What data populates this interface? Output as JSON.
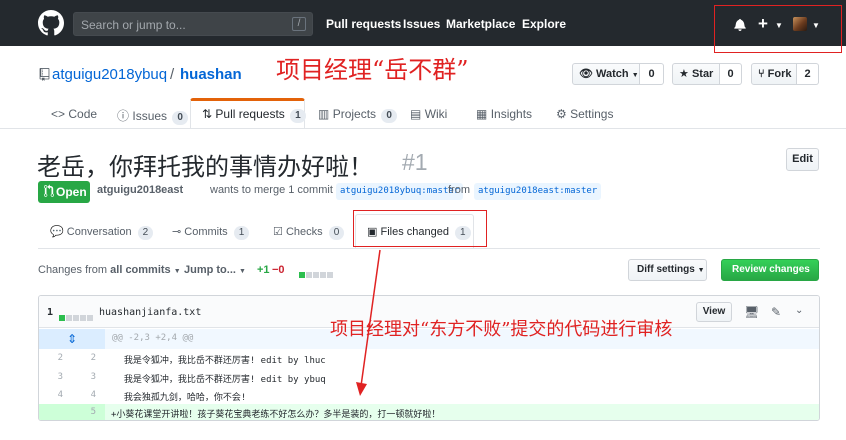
{
  "header": {
    "search_placeholder": "Search or jump to...",
    "slash_key": "/",
    "nav": [
      "Pull requests",
      "Issues",
      "Marketplace",
      "Explore"
    ]
  },
  "repo": {
    "owner": "atguigu2018ybuq",
    "separator": "/",
    "name": "huashan",
    "watch_label": "Watch",
    "watch_count": "0",
    "star_label": "Star",
    "star_count": "0",
    "fork_label": "Fork",
    "fork_count": "2"
  },
  "repo_tabs": [
    {
      "label": "Code"
    },
    {
      "label": "Issues",
      "count": "0"
    },
    {
      "label": "Pull requests",
      "count": "1"
    },
    {
      "label": "Projects",
      "count": "0"
    },
    {
      "label": "Wiki"
    },
    {
      "label": "Insights"
    },
    {
      "label": "Settings"
    }
  ],
  "annotations": {
    "manager": "项目经理“岳不群”",
    "review": "项目经理对“东方不败”提交的代码进行审核"
  },
  "pr": {
    "title": "老岳，你拜托我的事情办好啦！",
    "number": "#1",
    "edit_label": "Edit",
    "state": "Open",
    "author": "atguigu2018east",
    "action": "wants to merge 1 commit into",
    "base_branch": "atguigu2018ybuq:master",
    "from_word": "from",
    "head_branch": "atguigu2018east:master"
  },
  "pr_tabs": [
    {
      "label": "Conversation",
      "count": "2"
    },
    {
      "label": "Commits",
      "count": "1"
    },
    {
      "label": "Checks",
      "count": "0"
    },
    {
      "label": "Files changed",
      "count": "1"
    }
  ],
  "toolbar": {
    "changes_from": "Changes from",
    "all_commits": "all commits",
    "jump_to": "Jump to...",
    "additions": "+1",
    "deletions": "−0",
    "diff_settings": "Diff settings",
    "review_changes": "Review changes"
  },
  "file": {
    "changes": "1",
    "name": "huashanjianfa.txt",
    "view_label": "View",
    "hunk": "@@ -2,3 +2,4 @@",
    "lines": [
      {
        "old": "2",
        "new": "2",
        "text": "  我是令狐冲，我比岳不群还厉害! edit by lhuc",
        "type": "ctx"
      },
      {
        "old": "3",
        "new": "3",
        "text": "  我是令狐冲，我比岳不群还厉害! edit by ybuq",
        "type": "ctx"
      },
      {
        "old": "4",
        "new": "4",
        "text": "  我会独孤九剑，哈哈，你不会!",
        "type": "ctx"
      },
      {
        "old": "",
        "new": "5",
        "text": "+小葵花课堂开讲啦！孩子葵花宝典老练不好怎么办？多半是装的，打一顿就好啦！",
        "type": "add"
      }
    ]
  },
  "colors": {
    "header_bg": "#24292e",
    "link": "#0366d6",
    "open_green": "#28a745",
    "annotation_red": "#e02222",
    "active_tab_accent": "#e36209"
  }
}
